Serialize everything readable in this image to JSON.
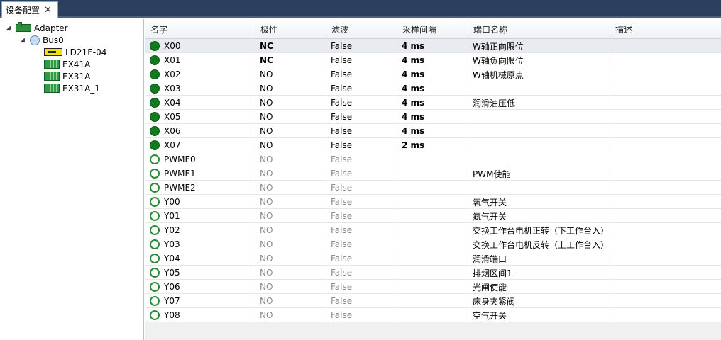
{
  "tab": {
    "label": "设备配置",
    "close": "✕"
  },
  "tree": [
    {
      "label": "Adapter",
      "icon": "adapter-icon",
      "expander": "◢"
    },
    {
      "label": "Bus0",
      "icon": "bus-icon",
      "expander": "◢"
    },
    {
      "label": "LD21E-04",
      "icon": "module-icon"
    },
    {
      "label": "EX41A",
      "icon": "io-board-icon"
    },
    {
      "label": "EX31A",
      "icon": "io-board-icon"
    },
    {
      "label": "EX31A_1",
      "icon": "io-board-icon"
    }
  ],
  "columns": [
    "名字",
    "极性",
    "滤波",
    "采样间隔",
    "端口名称",
    "描述"
  ],
  "rows": [
    {
      "name": "X00",
      "active": true,
      "polarity": "NC",
      "pol_bold": true,
      "filter": "False",
      "sample": "4 ms",
      "port": "W轴正向限位",
      "desc": ""
    },
    {
      "name": "X01",
      "active": true,
      "polarity": "NC",
      "pol_bold": true,
      "filter": "False",
      "sample": "4 ms",
      "port": "W轴负向限位",
      "desc": ""
    },
    {
      "name": "X02",
      "active": true,
      "polarity": "NO",
      "pol_bold": false,
      "filter": "False",
      "sample": "4 ms",
      "port": "W轴机械原点",
      "desc": ""
    },
    {
      "name": "X03",
      "active": true,
      "polarity": "NO",
      "pol_bold": false,
      "filter": "False",
      "sample": "4 ms",
      "port": "",
      "desc": ""
    },
    {
      "name": "X04",
      "active": true,
      "polarity": "NO",
      "pol_bold": false,
      "filter": "False",
      "sample": "4 ms",
      "port": "润滑油压低",
      "desc": ""
    },
    {
      "name": "X05",
      "active": true,
      "polarity": "NO",
      "pol_bold": false,
      "filter": "False",
      "sample": "4 ms",
      "port": "",
      "desc": ""
    },
    {
      "name": "X06",
      "active": true,
      "polarity": "NO",
      "pol_bold": false,
      "filter": "False",
      "sample": "4 ms",
      "port": "",
      "desc": ""
    },
    {
      "name": "X07",
      "active": true,
      "polarity": "NO",
      "pol_bold": false,
      "filter": "False",
      "sample": "2 ms",
      "port": "",
      "desc": ""
    },
    {
      "name": "PWME0",
      "active": false,
      "polarity": "NO",
      "pol_bold": false,
      "filter": "False",
      "sample": "",
      "port": "",
      "desc": ""
    },
    {
      "name": "PWME1",
      "active": false,
      "polarity": "NO",
      "pol_bold": false,
      "filter": "False",
      "sample": "",
      "port": "PWM使能",
      "desc": ""
    },
    {
      "name": "PWME2",
      "active": false,
      "polarity": "NO",
      "pol_bold": false,
      "filter": "False",
      "sample": "",
      "port": "",
      "desc": ""
    },
    {
      "name": "Y00",
      "active": false,
      "polarity": "NO",
      "pol_bold": false,
      "filter": "False",
      "sample": "",
      "port": "氧气开关",
      "desc": ""
    },
    {
      "name": "Y01",
      "active": false,
      "polarity": "NO",
      "pol_bold": false,
      "filter": "False",
      "sample": "",
      "port": "氮气开关",
      "desc": ""
    },
    {
      "name": "Y02",
      "active": false,
      "polarity": "NO",
      "pol_bold": false,
      "filter": "False",
      "sample": "",
      "port": "交换工作台电机正转（下工作台入）",
      "desc": ""
    },
    {
      "name": "Y03",
      "active": false,
      "polarity": "NO",
      "pol_bold": false,
      "filter": "False",
      "sample": "",
      "port": "交换工作台电机反转（上工作台入）",
      "desc": ""
    },
    {
      "name": "Y04",
      "active": false,
      "polarity": "NO",
      "pol_bold": false,
      "filter": "False",
      "sample": "",
      "port": "润滑端口",
      "desc": ""
    },
    {
      "name": "Y05",
      "active": false,
      "polarity": "NO",
      "pol_bold": false,
      "filter": "False",
      "sample": "",
      "port": "排烟区间1",
      "desc": ""
    },
    {
      "name": "Y06",
      "active": false,
      "polarity": "NO",
      "pol_bold": false,
      "filter": "False",
      "sample": "",
      "port": "光闸使能",
      "desc": ""
    },
    {
      "name": "Y07",
      "active": false,
      "polarity": "NO",
      "pol_bold": false,
      "filter": "False",
      "sample": "",
      "port": "床身夹紧阀",
      "desc": ""
    },
    {
      "name": "Y08",
      "active": false,
      "polarity": "NO",
      "pol_bold": false,
      "filter": "False",
      "sample": "",
      "port": "空气开关",
      "desc": ""
    }
  ]
}
